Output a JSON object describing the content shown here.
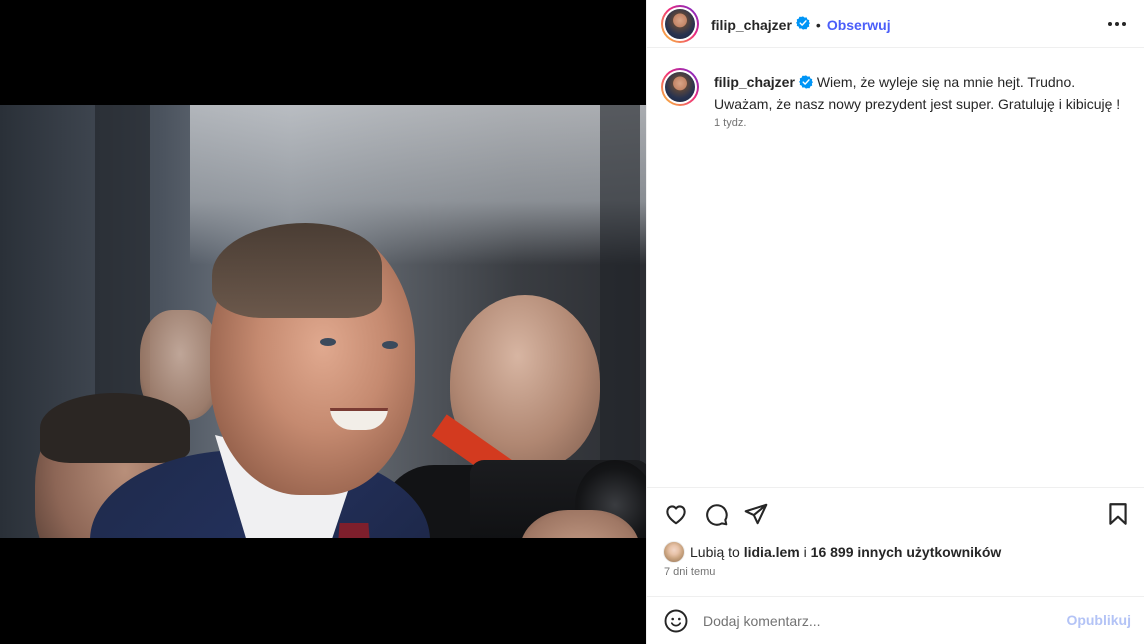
{
  "post": {
    "username": "filip_chajzer",
    "follow_label": "Obserwuj",
    "separator": "•",
    "caption_text": "Wiem, że wyleje się na mnie hejt. Trudno. Uważam, że nasz nowy prezydent jest super. Gratuluję i kibicuję !",
    "caption_time": "1 tydz.",
    "likes_prefix": "Lubią to",
    "likes_user": "lidia.lem",
    "likes_mid": "i",
    "likes_count": "16 899 innych użytkowników",
    "date": "7 dni temu"
  },
  "comment": {
    "placeholder": "Dodaj komentarz...",
    "post_label": "Opublikuj"
  },
  "icons": {
    "verified": "verified-badge-icon",
    "more": "more-options-icon",
    "like": "heart-icon",
    "comment": "comment-bubble-icon",
    "share": "paper-plane-icon",
    "save": "bookmark-icon",
    "emoji": "emoji-smiley-icon"
  },
  "colors": {
    "link_blue": "#4a5df9",
    "verified_blue": "#0095f6",
    "muted": "#737373",
    "post_disabled": "#b3c3f6"
  }
}
